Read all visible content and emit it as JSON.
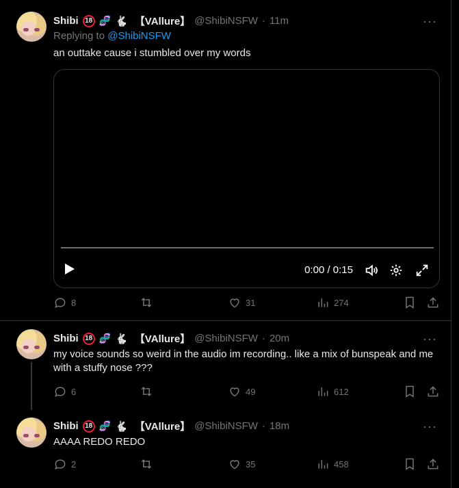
{
  "tweets": [
    {
      "name": "Shibi",
      "badge": "18",
      "tag": "【VAllure】",
      "handle": "@ShibiNSFW",
      "time": "11m",
      "replying_prefix": "Replying to ",
      "replying_to": "@ShibiNSFW",
      "text": "an outtake cause i stumbled over my words",
      "video": {
        "time": "0:00 / 0:15",
        "progress": 0
      },
      "replies": "8",
      "likes": "31",
      "views": "274"
    },
    {
      "name": "Shibi",
      "badge": "18",
      "tag": "【VAllure】",
      "handle": "@ShibiNSFW",
      "time": "20m",
      "text": "my voice sounds so weird in the audio im recording.. like a mix of bunspeak and me with a stuffy nose ???",
      "replies": "6",
      "likes": "49",
      "views": "612"
    },
    {
      "name": "Shibi",
      "badge": "18",
      "tag": "【VAllure】",
      "handle": "@ShibiNSFW",
      "time": "18m",
      "text": "AAAA REDO REDO",
      "replies": "2",
      "likes": "35",
      "views": "458"
    }
  ],
  "separator": " · ",
  "more_icon": "more-dots-icon"
}
